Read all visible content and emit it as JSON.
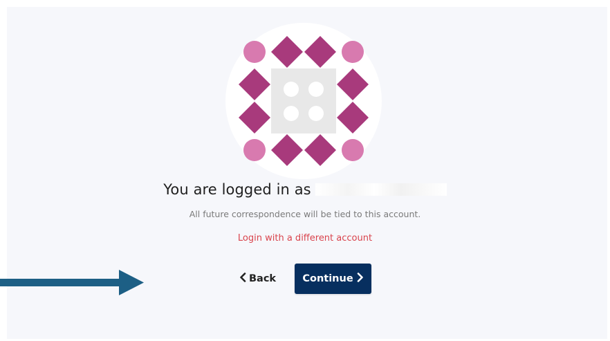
{
  "avatar": {
    "primary_color": "#a83a7c",
    "light_color": "#d87aaf",
    "tile_color": "#e8e8e8"
  },
  "login": {
    "title_prefix": "You are logged in as",
    "subtitle": "All future correspondence will be tied to this account.",
    "switch_account_link": "Login with a different account"
  },
  "actions": {
    "back_label": "Back",
    "back_icon": "chevron-left-icon",
    "continue_label": "Continue",
    "continue_icon": "chevron-right-icon",
    "continue_bg": "#072f5f"
  },
  "annotation": {
    "arrow_color": "#1d5f85"
  }
}
